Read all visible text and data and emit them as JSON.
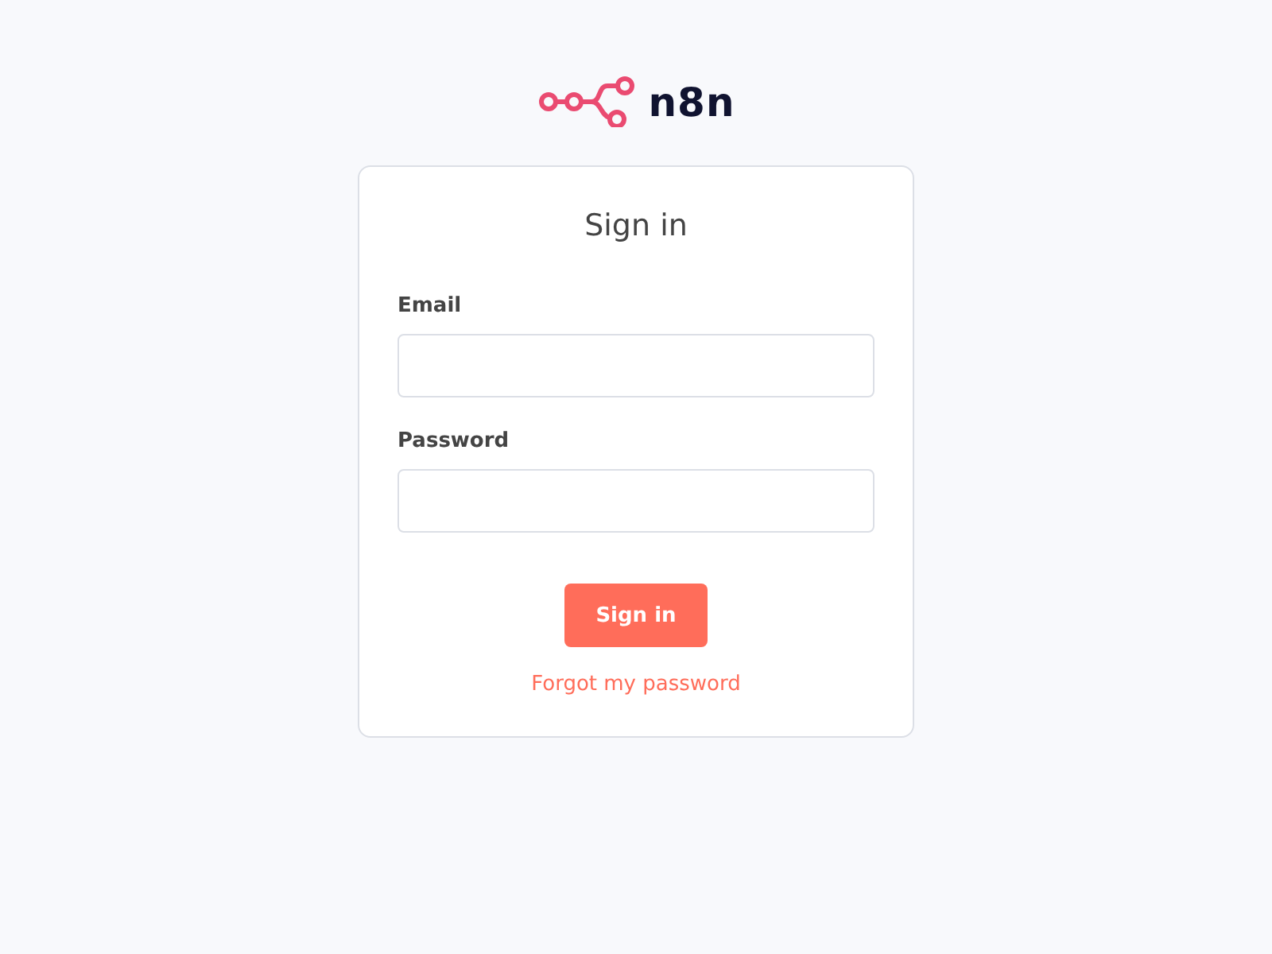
{
  "logo": {
    "text": "n8n"
  },
  "card": {
    "title": "Sign in",
    "fields": [
      {
        "label": "Email"
      },
      {
        "label": "Password"
      }
    ],
    "button": "Sign in",
    "link": "Forgot my password"
  }
}
